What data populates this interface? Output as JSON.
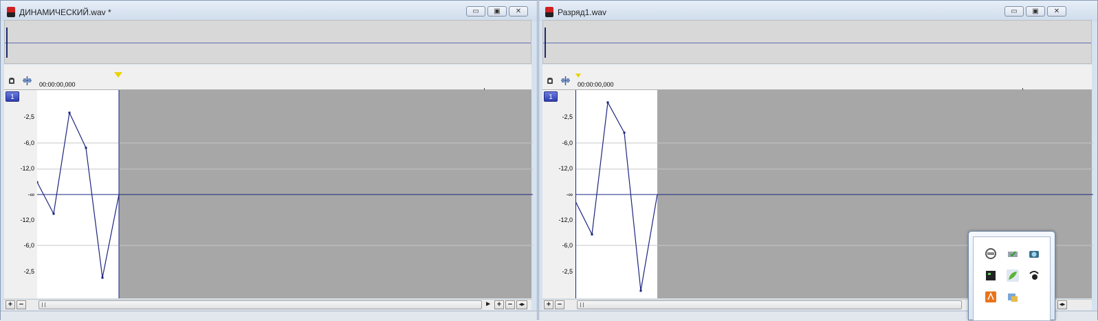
{
  "windows": [
    {
      "title": "ДИНАМИЧЕСКИЙ.wav *",
      "time_start": "00:00:00,000",
      "channel": "1",
      "db_labels": [
        "-2,5",
        "-6,0",
        "-12,0",
        "-∞",
        "-12,0",
        "-6,0",
        "-2,5"
      ]
    },
    {
      "title": "Разряд1.wav",
      "time_start": "00:00:00,000",
      "channel": "1",
      "db_labels": [
        "-2,5",
        "-6,0",
        "-12,0",
        "-∞",
        "-12,0",
        "-6,0",
        "-2,5"
      ]
    }
  ],
  "window_buttons": {
    "minimize": "▭",
    "maximize": "▣",
    "close": "✕"
  },
  "scroll_buttons": {
    "zoom_in": "+",
    "zoom_out": "−",
    "left": "◂",
    "right": "▸",
    "fit": "◂▸"
  },
  "tray_icons": [
    "cloud-sync-icon",
    "printer-check-icon",
    "camera-icon",
    "monitor-icon",
    "leaf-app-icon",
    "antenna-icon",
    "orange-app-icon",
    "network-folder-icon"
  ],
  "colors": {
    "waveform": "#1a237e",
    "selection": "#ffffff",
    "background": "#a7a7a7",
    "marker": "#e8d400",
    "channel_badge": "#3f4fc0"
  }
}
